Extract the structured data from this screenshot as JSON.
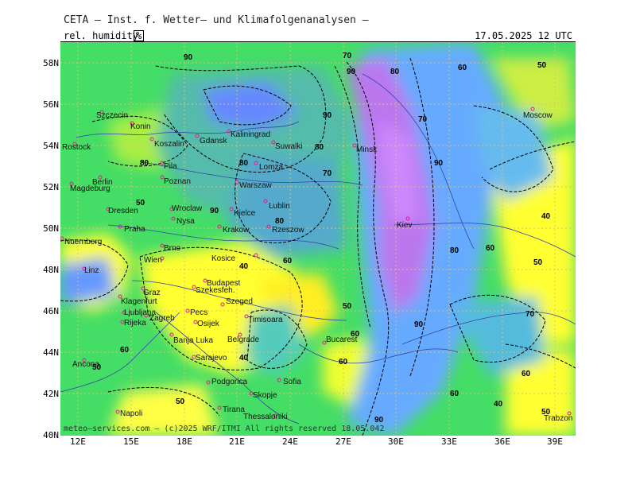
{
  "header": {
    "text": "CETA – Inst. f. Wetter– und Klimafolgenanalysen –"
  },
  "map": {
    "variable_label": "rel. humidity",
    "unit_label": "%",
    "valid_time": "17.05.2025 12 UTC",
    "lat_labels": [
      "58N",
      "56N",
      "54N",
      "52N",
      "50N",
      "48N",
      "46N",
      "44N",
      "42N",
      "40N"
    ],
    "lon_labels": [
      "12E",
      "15E",
      "18E",
      "21E",
      "24E",
      "27E",
      "30E",
      "33E",
      "36E",
      "39E"
    ],
    "footer": "meteo–services.com – (c)2025 WRF/ITMI All rights reserved 18.05.042",
    "cities": [
      "Rostock",
      "Berlin",
      "Magdeburg",
      "Dresden",
      "Praha",
      "Nuernberg",
      "Brno",
      "Wien",
      "Linz",
      "Graz",
      "Klagenfurt",
      "Ljubljana",
      "Zagreb",
      "Rijeka",
      "Pecs",
      "Osijek",
      "Banja Luka",
      "Sarajevo",
      "Budapest",
      "Szekesfeh.",
      "Szeged",
      "Belgrade",
      "Timisoara",
      "Bucarest",
      "Sofia",
      "Skopje",
      "Podgorica",
      "Tirana",
      "Thessaloniki",
      "Napoli",
      "Ancona",
      "Koszalin",
      "Gdansk",
      "Kaliningrad",
      "Suwalki",
      "Pila",
      "Poznan",
      "Lomza",
      "Warszaw",
      "Lublin",
      "Kielce",
      "Krakow",
      "Rzeszow",
      "Wroclaw",
      "Nysa",
      "Kosice",
      "Minsk",
      "Kiev",
      "Moscow",
      "Trabzon",
      "Szczecin",
      "Konin"
    ],
    "contour_labels": [
      "90",
      "80",
      "70",
      "60",
      "50",
      "40"
    ],
    "colors": {
      "dry": "#ffff33",
      "low": "#c8f533",
      "mid": "#33dd33",
      "moist": "#33ccaa",
      "wet": "#5599ff",
      "verywet": "#7788ff",
      "saturated": "#bb77ee"
    }
  }
}
